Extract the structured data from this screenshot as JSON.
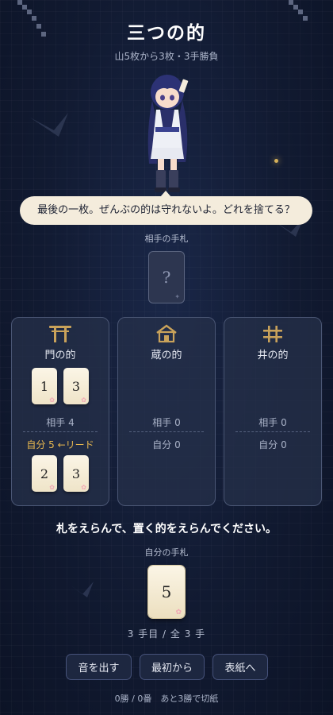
{
  "header": {
    "title": "三つの的",
    "subtitle": "山5枚から3枚・3手勝負"
  },
  "dialogue": {
    "text": "最後の一枚。ぜんぶの的は守れないよ。どれを捨てる？"
  },
  "opponent": {
    "label": "相手の手札",
    "hidden_card": "?"
  },
  "targets": [
    {
      "name": "門の的",
      "icon": "torii-icon",
      "opp_cards": [
        "1",
        "3"
      ],
      "opp_score": "相手 4",
      "my_score": "自分 5 ←リード",
      "my_cards": [
        "2",
        "3"
      ],
      "leading": true
    },
    {
      "name": "蔵の的",
      "icon": "storehouse-icon",
      "opp_cards": [],
      "opp_score": "相手 0",
      "my_score": "自分 0",
      "my_cards": [],
      "leading": false
    },
    {
      "name": "井の的",
      "icon": "well-icon",
      "opp_cards": [],
      "opp_score": "相手 0",
      "my_score": "自分 0",
      "my_cards": [],
      "leading": false
    }
  ],
  "prompt": {
    "instruction": "札をえらんで、置く的をえらんでください。"
  },
  "player": {
    "label": "自分の手札",
    "cards": [
      "5"
    ]
  },
  "turn": {
    "text": "3 手目 / 全 3 手"
  },
  "controls": {
    "sound": "音を出す",
    "restart": "最初から",
    "to_title": "表紙へ"
  },
  "footer": {
    "record": "0勝 / 0番　あと3勝で切紙"
  },
  "colors": {
    "accent_gold": "#c9a25a",
    "lead": "#e8b84f",
    "card": "#f6eedb",
    "panel": "#26304a"
  }
}
